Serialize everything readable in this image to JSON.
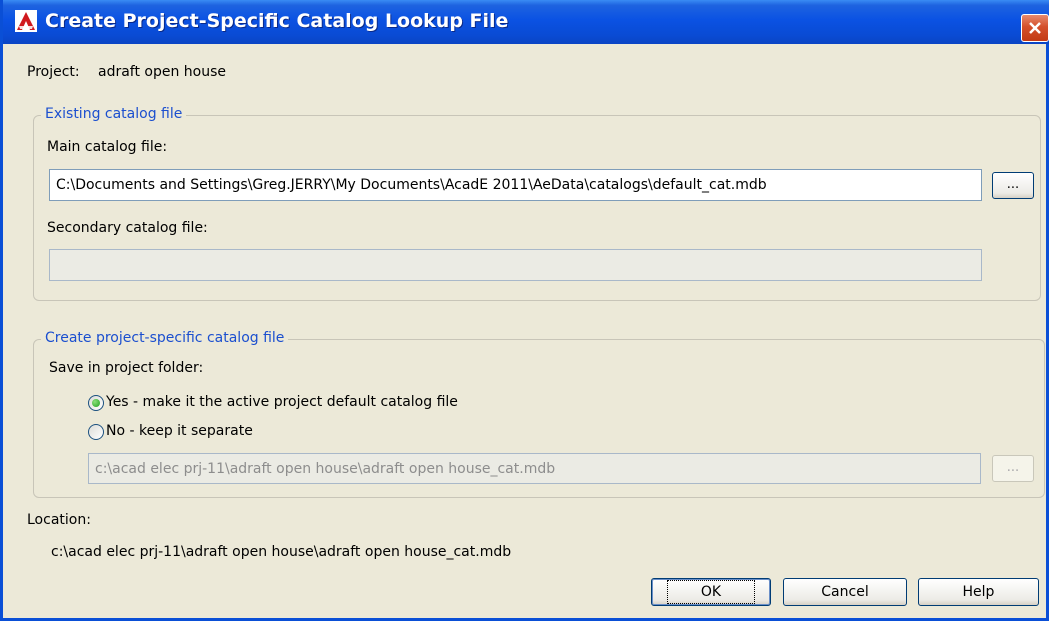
{
  "window": {
    "title": "Create Project-Specific Catalog Lookup File",
    "colors": {
      "titlebar": "#0a4fd6",
      "accent": "#1b4fcf",
      "background": "#ece9d8"
    }
  },
  "project": {
    "label": "Project:",
    "value": "adraft open house"
  },
  "existing_group": {
    "legend": "Existing catalog file",
    "main_label": "Main catalog file:",
    "main_value": "C:\\Documents and Settings\\Greg.JERRY\\My Documents\\AcadE 2011\\AeData\\catalogs\\default_cat.mdb",
    "browse_label": "...",
    "secondary_label": "Secondary catalog file:",
    "secondary_value": ""
  },
  "create_group": {
    "legend": "Create project-specific catalog file",
    "save_label": "Save in project folder:",
    "options": [
      {
        "label": "Yes - make it the active project default catalog file",
        "selected": true
      },
      {
        "label": "No - keep it separate",
        "selected": false
      }
    ],
    "path_value": "c:\\acad elec prj-11\\adraft open house\\adraft open house_cat.mdb",
    "browse_label": "..."
  },
  "location": {
    "label": "Location:",
    "value": "c:\\acad elec prj-11\\adraft open house\\adraft open house_cat.mdb"
  },
  "buttons": {
    "ok": "OK",
    "cancel": "Cancel",
    "help": "Help"
  }
}
